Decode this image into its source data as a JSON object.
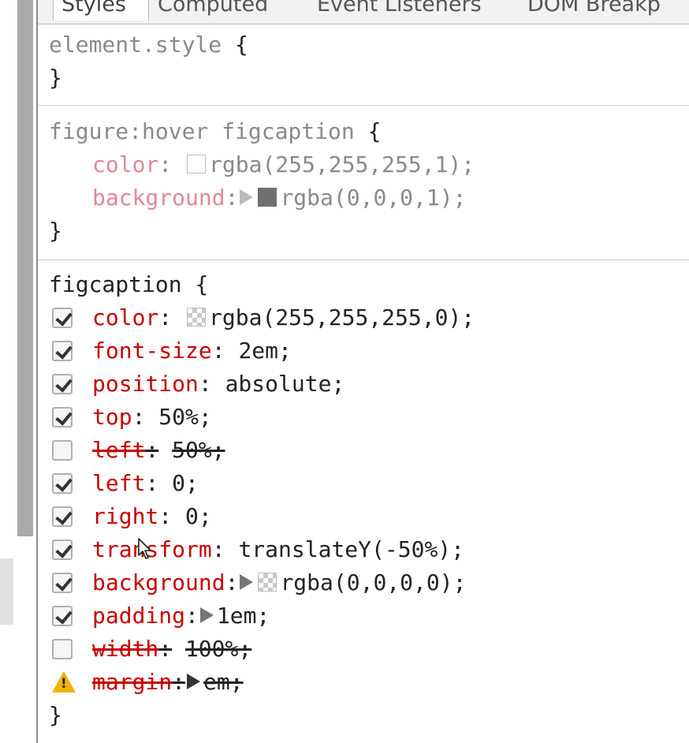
{
  "tabs": [
    "Styles",
    "Computed",
    "Event Listeners",
    "DOM Breakp"
  ],
  "rules": {
    "element_style": {
      "selector": "element.style",
      "open": "{",
      "close": "}"
    },
    "hover": {
      "selector": "figure:hover figcaption",
      "open": "{",
      "close": "}",
      "props": [
        {
          "name": "color",
          "colon": ":",
          "value": "rgba(255,255,255,1);"
        },
        {
          "name": "background",
          "colon": ":",
          "value": "rgba(0,0,0,1);"
        }
      ]
    },
    "figcaption": {
      "selector": "figcaption",
      "open": "{",
      "close": "}",
      "props": [
        {
          "name": "color",
          "colon": ":",
          "value": "rgba(255,255,255,0);",
          "enabled": true
        },
        {
          "name": "font-size",
          "colon": ":",
          "value": "2em;",
          "enabled": true
        },
        {
          "name": "position",
          "colon": ":",
          "value": "absolute;",
          "enabled": true
        },
        {
          "name": "top",
          "colon": ":",
          "value": "50%;",
          "enabled": true
        },
        {
          "name": "left",
          "colon": ":",
          "value": "50%;",
          "enabled": false
        },
        {
          "name": "left",
          "colon": ":",
          "value": "0;",
          "enabled": true
        },
        {
          "name": "right",
          "colon": ":",
          "value": "0;",
          "enabled": true
        },
        {
          "name": "transform",
          "colon": ":",
          "value": "translateY(-50%);",
          "enabled": true
        },
        {
          "name": "background",
          "colon": ":",
          "value": "rgba(0,0,0,0);",
          "enabled": true
        },
        {
          "name": "padding",
          "colon": ":",
          "value": "1em;",
          "enabled": true
        },
        {
          "name": "width",
          "colon": ":",
          "value": "100%;",
          "enabled": false
        },
        {
          "name": "margin",
          "colon": ":",
          "value": "em;",
          "enabled": false,
          "warning": true
        }
      ]
    }
  },
  "icons": {
    "checkbox": "checkbox-icon",
    "warning": "warning-icon",
    "expand": "expand-triangle-icon",
    "color_swatch": "color-swatch-icon",
    "cursor": "mouse-cursor-icon"
  },
  "colors": {
    "property_name": "#c80000",
    "property_name_inactive": "#e08a92",
    "warning": "#f2b200"
  }
}
